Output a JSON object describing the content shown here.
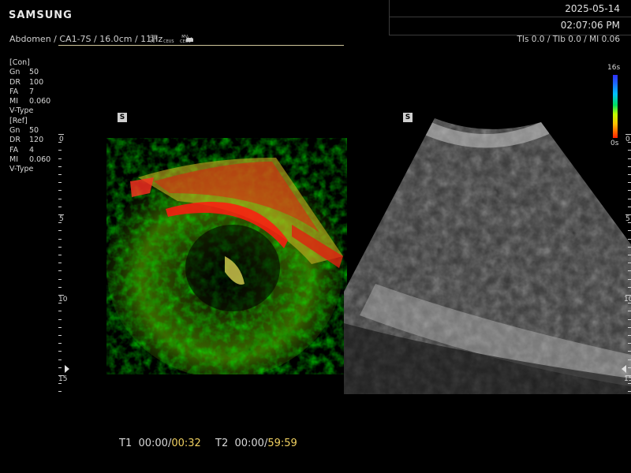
{
  "header": {
    "logo": "SAMSUNG",
    "date": "2025-05-14",
    "time": "02:07:06 PM",
    "preset": "Abdomen / CA1-7S / 16.0cm / 11Hz",
    "mode_icons": [
      {
        "top": "LOW",
        "bottom": "MI"
      },
      {
        "top": "",
        "bottom": "CEUS"
      },
      {
        "top": "MV-",
        "bottom": "CEUS"
      }
    ],
    "probe_icon": "probe-icon",
    "indices": "TIs  0.0 / TIb  0.0 / MI  0.06"
  },
  "params": {
    "con": {
      "title": "[Con]",
      "rows": [
        {
          "k": "Gn",
          "v": "50"
        },
        {
          "k": "DR",
          "v": "100"
        },
        {
          "k": "FA",
          "v": "7"
        },
        {
          "k": "MI",
          "v": "0.060"
        }
      ],
      "type": "V-Type"
    },
    "ref": {
      "title": "[Ref]",
      "rows": [
        {
          "k": "Gn",
          "v": "50"
        },
        {
          "k": "DR",
          "v": "120"
        },
        {
          "k": "FA",
          "v": "4"
        },
        {
          "k": "MI",
          "v": "0.060"
        }
      ],
      "type": "V-Type"
    }
  },
  "images": {
    "left_marker": "S",
    "right_marker": "S",
    "depth_labels": [
      "0",
      "5",
      "10",
      "15"
    ]
  },
  "colorbar": {
    "top_label": "16s",
    "bottom_label": "0s",
    "colors": [
      "#3030ff",
      "#00c0ff",
      "#00e060",
      "#c0ff00",
      "#ffc000",
      "#ff2000"
    ]
  },
  "timers": {
    "t1_label": "T1",
    "t1_start": "00:00",
    "t1_end": "00:32",
    "t2_label": "T2",
    "t2_start": "00:00",
    "t2_end": "59:59"
  }
}
